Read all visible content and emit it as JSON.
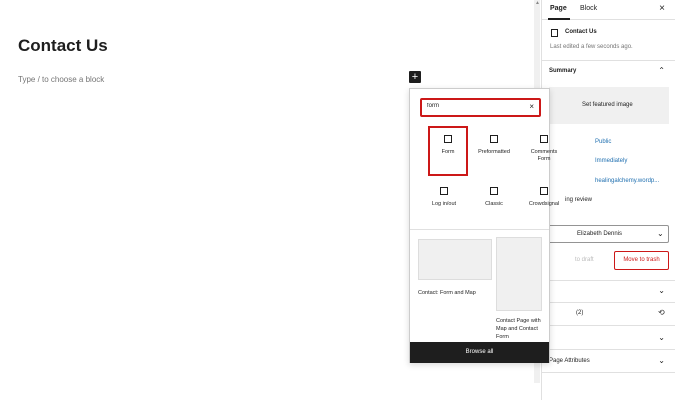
{
  "editor": {
    "page_title": "Contact Us",
    "block_placeholder": "Type / to choose a block",
    "add_block": "+"
  },
  "sidebar": {
    "tabs": [
      {
        "label": "Page"
      },
      {
        "label": "Block"
      }
    ],
    "close": "×",
    "doc_title": "Contact Us",
    "last_edited": "Last edited a few seconds ago.",
    "summary_label": "Summary",
    "featured_image": "Set featured image",
    "visibility": "Public",
    "publish": "Immediately",
    "url": "healingalchemy.wordp...",
    "pending_review": "ing review",
    "author": "Elizabeth Dennis",
    "switch_draft": "to draft",
    "move_to_trash": "Move to trash",
    "revisions": "(2)",
    "page_attributes": "Page Attributes"
  },
  "inserter": {
    "search": {
      "value": "form",
      "clear": "×"
    },
    "blocks": [
      {
        "label": "Form"
      },
      {
        "label": "Preformatted"
      },
      {
        "label": "Comments Form"
      },
      {
        "label": "Log in/out"
      },
      {
        "label": "Classic"
      },
      {
        "label": "Crowdsignal"
      }
    ],
    "patterns": [
      {
        "label": "Contact: Form and Map"
      },
      {
        "label": "Contact Page with Map and Contact Form"
      }
    ],
    "browse_all": "Browse all"
  }
}
